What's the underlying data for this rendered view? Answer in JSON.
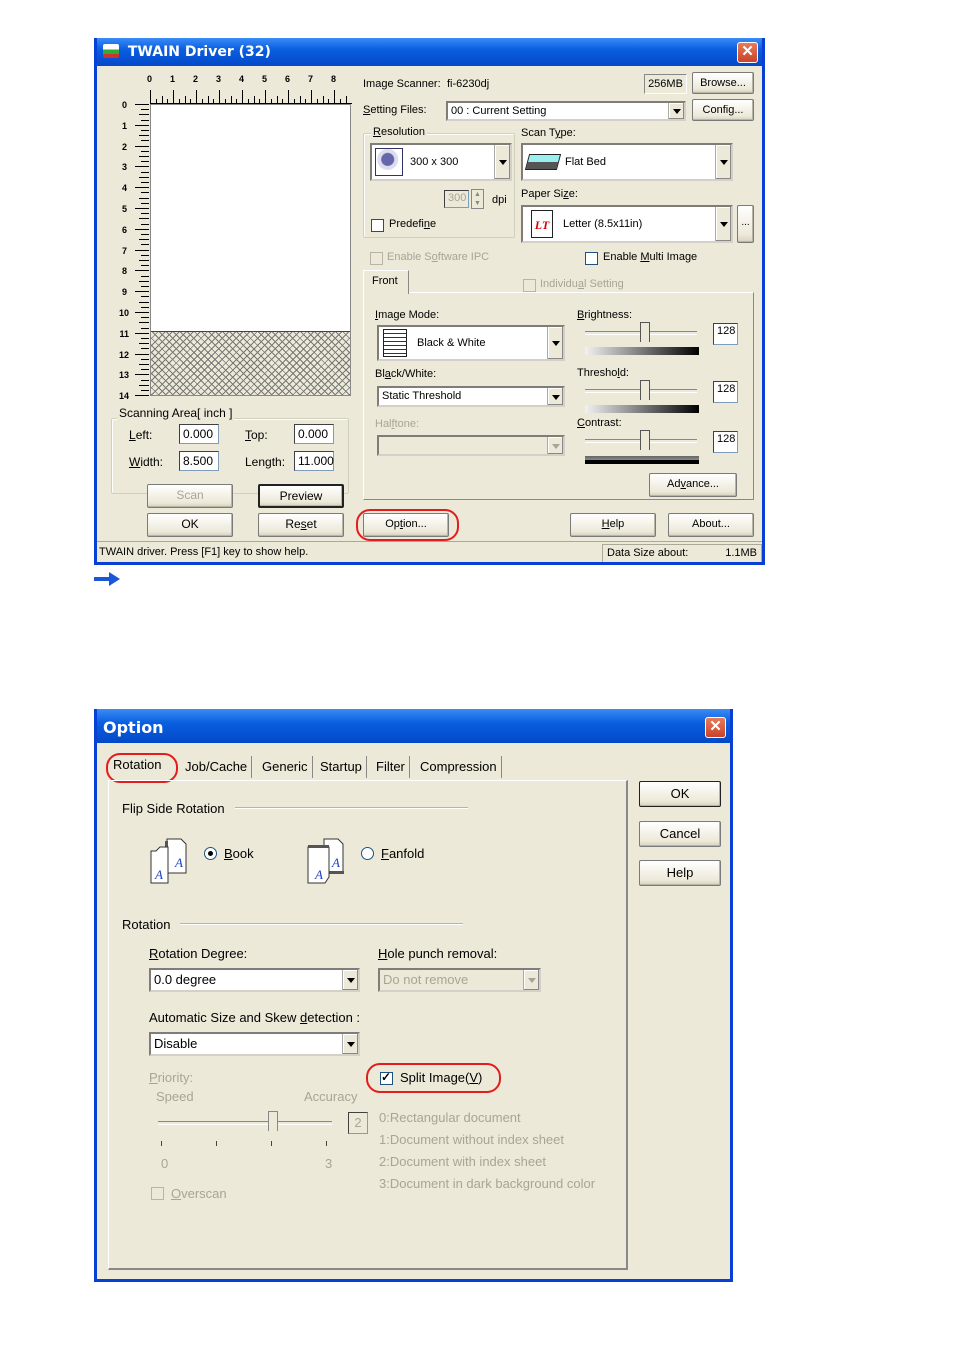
{
  "twain": {
    "title": "TWAIN Driver (32)",
    "ruler_h": [
      "0",
      "1",
      "2",
      "3",
      "4",
      "5",
      "6",
      "7",
      "8"
    ],
    "ruler_v": [
      "0",
      "1",
      "2",
      "3",
      "4",
      "5",
      "6",
      "7",
      "8",
      "9",
      "10",
      "11",
      "12",
      "13",
      "14"
    ],
    "scanner_label": "Image Scanner:",
    "scanner_value": "fi-6230dj",
    "memory": "256MB",
    "browse_btn": "Browse...",
    "setting_files_label": "Setting Files:",
    "setting_files_value": "00 : Current Setting",
    "config_btn": "Config...",
    "resolution_group": "Resolution",
    "resolution_value": "300 x 300",
    "dpi_value": "300",
    "dpi_label": "dpi",
    "predefine_label": "Predefine",
    "scan_type_label": "Scan Type:",
    "scan_type_value": "Flat Bed",
    "paper_size_label": "Paper Size:",
    "paper_size_value": "Letter (8.5x11in)",
    "paper_icon_text": "LT",
    "paper_more_btn": "...",
    "enable_ipc_label": "Enable Software IPC",
    "enable_multi_label": "Enable Multi Image",
    "front_tab": "Front",
    "individual_setting_label": "Individual Setting",
    "image_mode_label": "Image Mode:",
    "image_mode_value": "Black & White",
    "bw_label": "Black/White:",
    "bw_value": "Static Threshold",
    "halftone_label": "Halftone:",
    "brightness_label": "Brightness:",
    "brightness_value": "128",
    "threshold_label": "Threshold:",
    "threshold_value": "128",
    "contrast_label": "Contrast:",
    "contrast_value": "128",
    "advance_btn": "Advance...",
    "scanning_area_group": "Scanning Area[ inch ]",
    "left_label": "Left:",
    "left_value": "0.000",
    "top_label": "Top:",
    "top_value": "0.000",
    "width_label": "Width:",
    "width_value": "8.500",
    "length_label": "Length:",
    "length_value": "11.000",
    "scan_btn": "Scan",
    "preview_btn": "Preview",
    "ok_btn": "OK",
    "reset_btn": "Reset",
    "option_btn": "Option...",
    "help_btn": "Help",
    "about_btn": "About...",
    "status_text": "TWAIN driver. Press [F1] key to show help.",
    "data_size_label": "Data Size about:",
    "data_size_value": "1.1MB"
  },
  "option": {
    "title": "Option",
    "tabs": [
      "Rotation",
      "Job/Cache",
      "Generic",
      "Startup",
      "Filter",
      "Compression"
    ],
    "ok_btn": "OK",
    "cancel_btn": "Cancel",
    "help_btn": "Help",
    "flip_group": "Flip Side Rotation",
    "book_label": "Book",
    "fanfold_label": "Fanfold",
    "rotation_group": "Rotation",
    "rotation_degree_label": "Rotation Degree:",
    "rotation_degree_value": "0.0 degree",
    "hole_punch_label": "Hole punch removal:",
    "hole_punch_value": "Do not remove",
    "auto_size_label": "Automatic Size and Skew detection :",
    "auto_size_value": "Disable",
    "priority_label": "Priority:",
    "speed_label": "Speed",
    "accuracy_label": "Accuracy",
    "priority_value": "2",
    "priority_min": "0",
    "priority_max": "3",
    "split_image_label": "Split Image(V)",
    "priority_options": [
      "0:Rectangular document",
      "1:Document without index sheet",
      "2:Document with index sheet",
      "3:Document in dark background color"
    ],
    "overscan_label": "Overscan"
  },
  "colors": {
    "highlight": "#e31d1d",
    "titlebar": "#0a5fe0",
    "arrow": "#1a56d8"
  }
}
